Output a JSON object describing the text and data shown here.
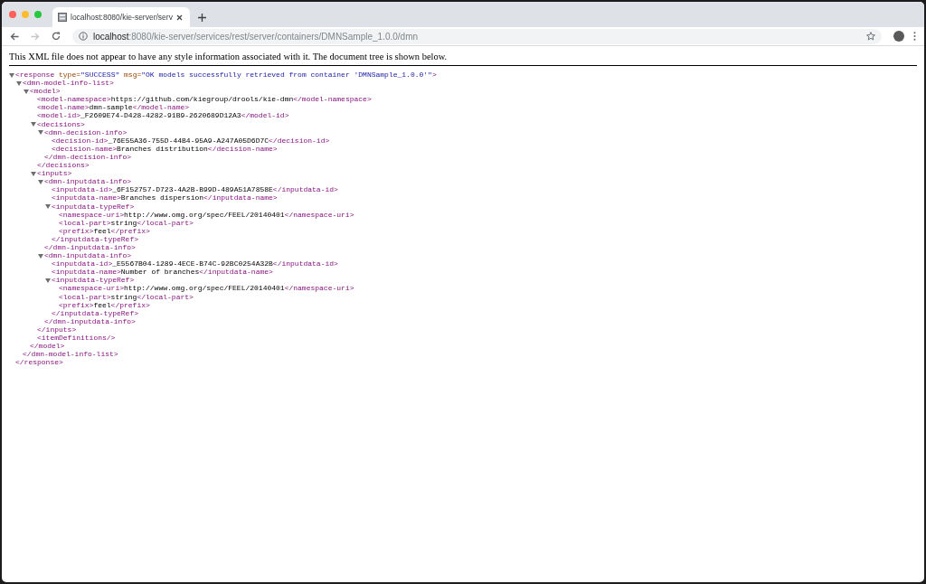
{
  "browser": {
    "tab": {
      "title": "localhost:8080/kie-server/serv",
      "selected": true
    },
    "url_host": "localhost",
    "url_path": ":8080/kie-server/services/rest/server/containers/DMNSample_1.0.0/dmn",
    "forward_disabled": true,
    "bookmarked": false
  },
  "notice": "This XML file does not appear to have any style information associated with it. The document tree is shown below.",
  "tree": [
    {
      "kind": "element",
      "expanded": true,
      "start": [
        {
          "kind": "tag",
          "text": "<response"
        },
        {
          "kind": "attr-name",
          "text": " type="
        },
        {
          "kind": "attr-value",
          "text": "\"SUCCESS\""
        },
        {
          "kind": "attr-name",
          "text": " msg="
        },
        {
          "kind": "attr-value",
          "text": "\"OK models successfully retrieved from container 'DMNSample_1.0.0'\""
        },
        {
          "kind": "tag",
          "text": ">"
        }
      ],
      "end": "</response>",
      "children": [
        {
          "kind": "element",
          "expanded": true,
          "start": "<dmn-model-info-list>",
          "end": "</dmn-model-info-list>",
          "children": [
            {
              "kind": "element",
              "expanded": true,
              "start": "<model>",
              "end": "</model>",
              "children": [
                {
                  "kind": "leaf",
                  "start": "<model-namespace>",
                  "text": "https://github.com/kiegroup/drools/kie-dmn",
                  "end": "</model-namespace>"
                },
                {
                  "kind": "leaf",
                  "start": "<model-name>",
                  "text": "dmn-sample",
                  "end": "</model-name>"
                },
                {
                  "kind": "leaf",
                  "start": "<model-id>",
                  "text": "_F2609E74-D428-4282-91B9-2620689D12A3",
                  "end": "</model-id>"
                },
                {
                  "kind": "element",
                  "expanded": true,
                  "start": "<decisions>",
                  "end": "</decisions>",
                  "children": [
                    {
                      "kind": "element",
                      "expanded": true,
                      "start": "<dmn-decision-info>",
                      "end": "</dmn-decision-info>",
                      "children": [
                        {
                          "kind": "leaf",
                          "start": "<decision-id>",
                          "text": "_76E55A36-755D-44B4-95A9-A247A05D6D7C",
                          "end": "</decision-id>"
                        },
                        {
                          "kind": "leaf",
                          "start": "<decision-name>",
                          "text": "Branches distribution",
                          "end": "</decision-name>"
                        }
                      ]
                    }
                  ]
                },
                {
                  "kind": "element",
                  "expanded": true,
                  "start": "<inputs>",
                  "end": "</inputs>",
                  "children": [
                    {
                      "kind": "element",
                      "expanded": true,
                      "start": "<dmn-inputdata-info>",
                      "end": "</dmn-inputdata-info>",
                      "children": [
                        {
                          "kind": "leaf",
                          "start": "<inputdata-id>",
                          "text": "_6F152757-D723-4A2B-B99D-489A51A7858E",
                          "end": "</inputdata-id>"
                        },
                        {
                          "kind": "leaf",
                          "start": "<inputdata-name>",
                          "text": "Branches dispersion",
                          "end": "</inputdata-name>"
                        },
                        {
                          "kind": "element",
                          "expanded": true,
                          "start": "<inputdata-typeRef>",
                          "end": "</inputdata-typeRef>",
                          "children": [
                            {
                              "kind": "leaf",
                              "start": "<namespace-uri>",
                              "text": "http://www.omg.org/spec/FEEL/20140401",
                              "end": "</namespace-uri>"
                            },
                            {
                              "kind": "leaf",
                              "start": "<local-part>",
                              "text": "string",
                              "end": "</local-part>"
                            },
                            {
                              "kind": "leaf",
                              "start": "<prefix>",
                              "text": "feel",
                              "end": "</prefix>"
                            }
                          ]
                        }
                      ]
                    },
                    {
                      "kind": "element",
                      "expanded": true,
                      "start": "<dmn-inputdata-info>",
                      "end": "</dmn-inputdata-info>",
                      "children": [
                        {
                          "kind": "leaf",
                          "start": "<inputdata-id>",
                          "text": "_E5567B04-1289-4ECE-B74C-92BC0254A32B",
                          "end": "</inputdata-id>"
                        },
                        {
                          "kind": "leaf",
                          "start": "<inputdata-name>",
                          "text": "Number of branches",
                          "end": "</inputdata-name>"
                        },
                        {
                          "kind": "element",
                          "expanded": true,
                          "start": "<inputdata-typeRef>",
                          "end": "</inputdata-typeRef>",
                          "children": [
                            {
                              "kind": "leaf",
                              "start": "<namespace-uri>",
                              "text": "http://www.omg.org/spec/FEEL/20140401",
                              "end": "</namespace-uri>"
                            },
                            {
                              "kind": "leaf",
                              "start": "<local-part>",
                              "text": "string",
                              "end": "</local-part>"
                            },
                            {
                              "kind": "leaf",
                              "start": "<prefix>",
                              "text": "feel",
                              "end": "</prefix>"
                            }
                          ]
                        }
                      ]
                    }
                  ]
                },
                {
                  "kind": "empty",
                  "start": "<itemDefinitions/>"
                }
              ]
            }
          ]
        }
      ]
    }
  ]
}
